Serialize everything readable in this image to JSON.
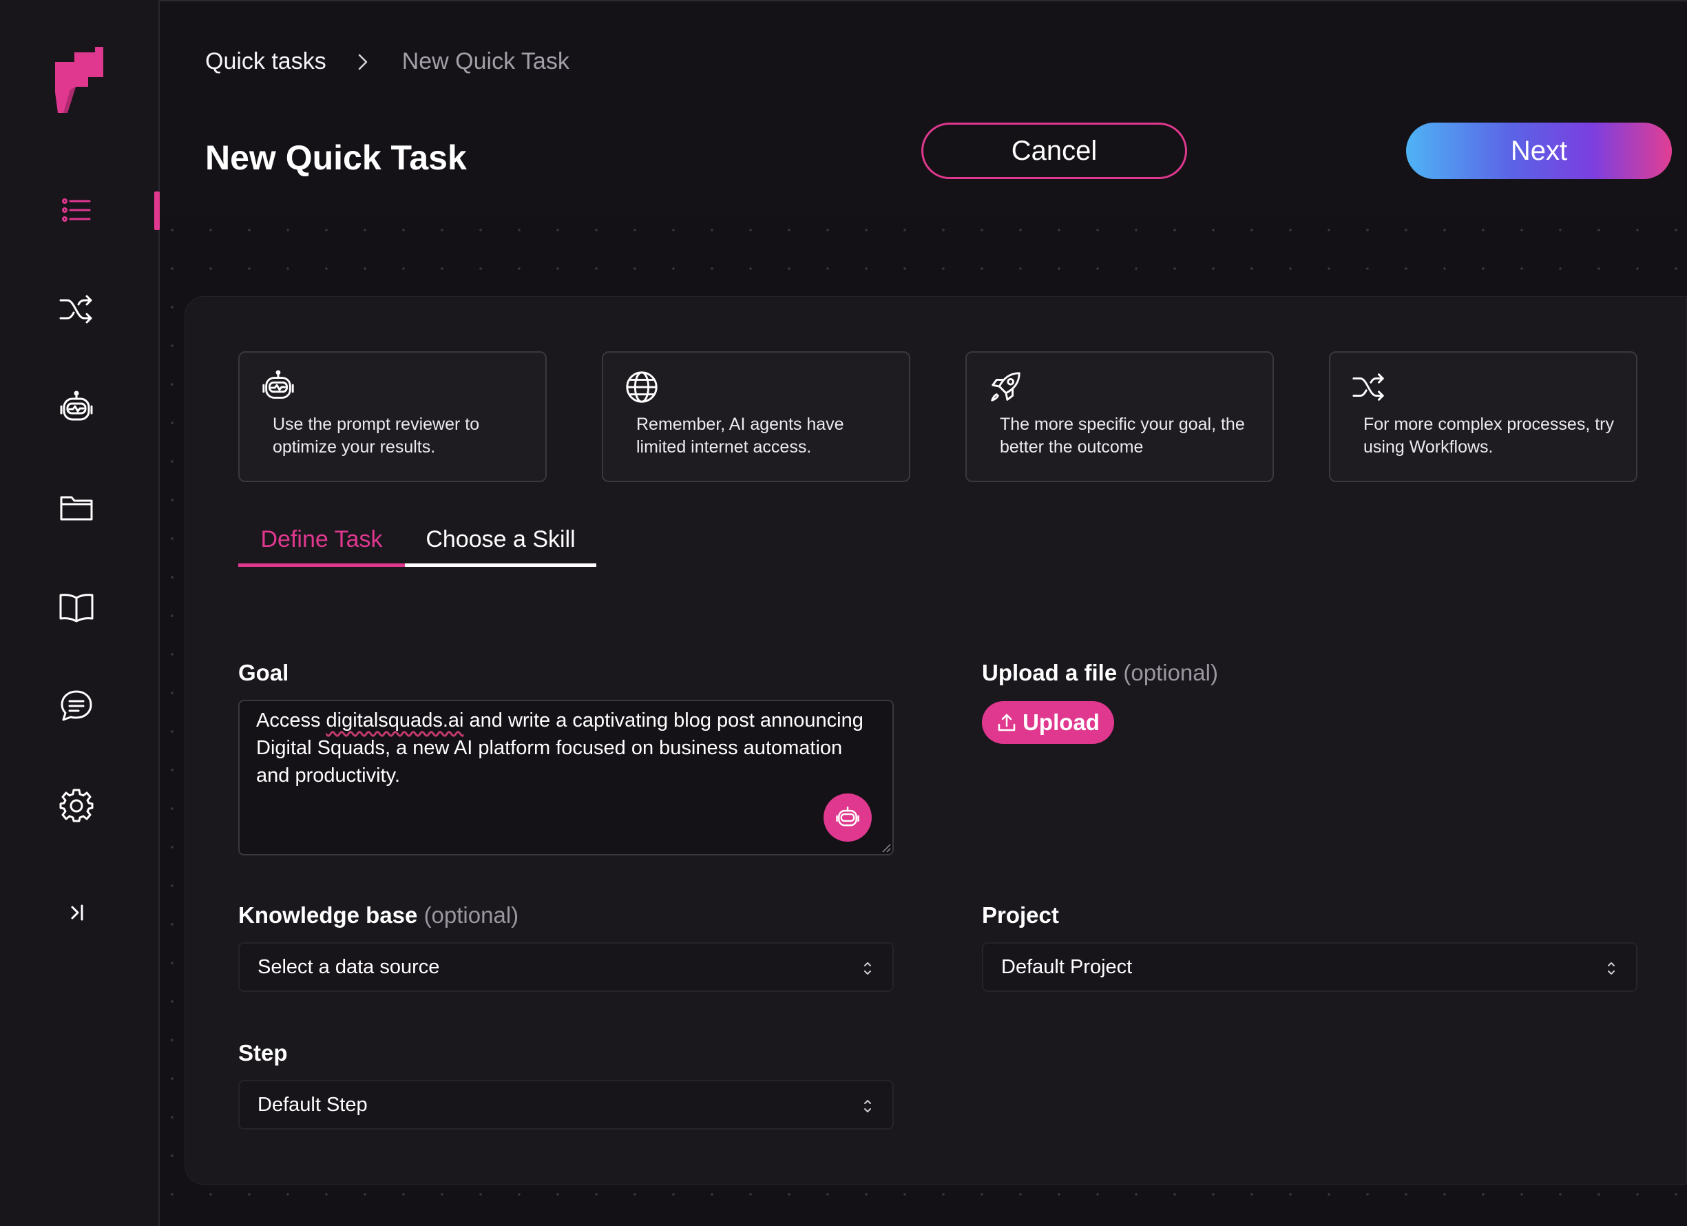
{
  "sidebar": {
    "items": [
      {
        "name": "quick-tasks",
        "icon": "list-icon",
        "active": true
      },
      {
        "name": "workflows",
        "icon": "shuffle-icon"
      },
      {
        "name": "agents",
        "icon": "robot-icon"
      },
      {
        "name": "files",
        "icon": "folder-icon"
      },
      {
        "name": "knowledge",
        "icon": "book-icon"
      },
      {
        "name": "chat",
        "icon": "chat-icon"
      },
      {
        "name": "settings",
        "icon": "gear-icon"
      },
      {
        "name": "collapse",
        "icon": "collapse-sidebar-icon"
      }
    ],
    "accent": "#e0388f"
  },
  "header": {
    "breadcrumb_root": "Quick tasks",
    "breadcrumb_current": "New Quick Task",
    "title": "New Quick Task",
    "cancel_label": "Cancel",
    "next_label": "Next"
  },
  "tips": [
    {
      "icon": "robot-icon",
      "text": "Use the prompt reviewer to optimize your results."
    },
    {
      "icon": "globe-icon",
      "text": "Remember, AI agents have limited internet access."
    },
    {
      "icon": "rocket-icon",
      "text": "The more specific your goal, the better the outcome"
    },
    {
      "icon": "shuffle-icon",
      "text": "For more complex processes, try using Workflows."
    }
  ],
  "tabs": {
    "define": "Define Task",
    "skill": "Choose a Skill",
    "active": "define"
  },
  "form": {
    "goal_label": "Goal",
    "goal_value_pre": "Access ",
    "goal_value_link": "digitalsquads.ai",
    "goal_value_post": " and write a captivating blog post announcing Digital Squads, a new AI platform focused on business automation and productivity.",
    "upload_label": "Upload a file",
    "upload_optional": "(optional)",
    "upload_button": "Upload",
    "kb_label": "Knowledge base",
    "kb_optional": "(optional)",
    "kb_value": "Select a data source",
    "project_label": "Project",
    "project_value": "Default Project",
    "step_label": "Step",
    "step_value": "Default Step"
  }
}
